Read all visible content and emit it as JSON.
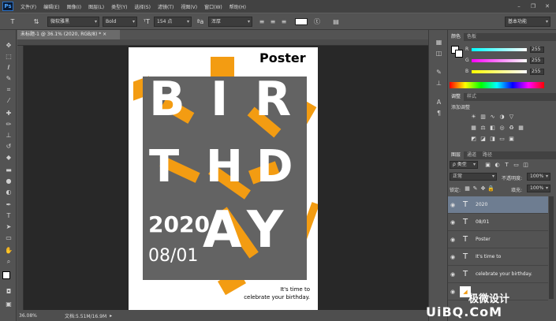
{
  "app": {
    "logo": "Ps"
  },
  "menu": {
    "items": [
      "文件(F)",
      "编辑(E)",
      "图像(I)",
      "图层(L)",
      "类型(Y)",
      "选择(S)",
      "滤镜(T)",
      "视图(V)",
      "窗口(W)",
      "帮助(H)"
    ]
  },
  "window_controls": {
    "minimize": "–",
    "restore": "❐",
    "close": "✕"
  },
  "options": {
    "font_family": "微软雅黑",
    "font_style": "Bold",
    "font_size": "154 点",
    "antialias": "浑厚",
    "workspace": "基本功能"
  },
  "document": {
    "tab_title": "未标题-1 @ 36.1% (2020, RGB/8) *",
    "tab_close": "×"
  },
  "poster": {
    "title": "Poster",
    "letters": [
      "B",
      "I",
      "R",
      "T",
      "H",
      "D",
      "A",
      "Y"
    ],
    "year": "2020",
    "date": "08/01",
    "tagline_1": "It's time to",
    "tagline_2": "celebrate your birthday."
  },
  "status": {
    "zoom": "36.08%",
    "doc": "文档:5.51M/16.9M"
  },
  "color_panel": {
    "tabs": [
      "颜色",
      "色板"
    ],
    "r_label": "R",
    "g_label": "G",
    "b_label": "B",
    "r": "255",
    "g": "255",
    "b": "255"
  },
  "adjust_panel": {
    "tabs": [
      "调整",
      "样式"
    ],
    "title": "添加调整"
  },
  "layers_panel": {
    "tabs": [
      "图层",
      "通道",
      "路径"
    ],
    "filter": "ρ 类型",
    "blend": "正常",
    "opacity_label": "不透明度:",
    "opacity": "100%",
    "lock_label": "锁定:",
    "fill_label": "填充:",
    "fill": "100%",
    "layers": [
      {
        "name": "2020",
        "selected": true
      },
      {
        "name": "08/01",
        "selected": false
      },
      {
        "name": "Poster",
        "selected": false
      },
      {
        "name": "It's time to",
        "selected": false
      },
      {
        "name": "celebrate your birthday.",
        "selected": false
      },
      {
        "name": "",
        "selected": false
      }
    ]
  },
  "watermark": {
    "text": "极微设计",
    "site": "UiBQ.CoM"
  },
  "colors": {
    "accent": "#f39c12",
    "grey": "#636363",
    "selected": "#6e7d91"
  }
}
